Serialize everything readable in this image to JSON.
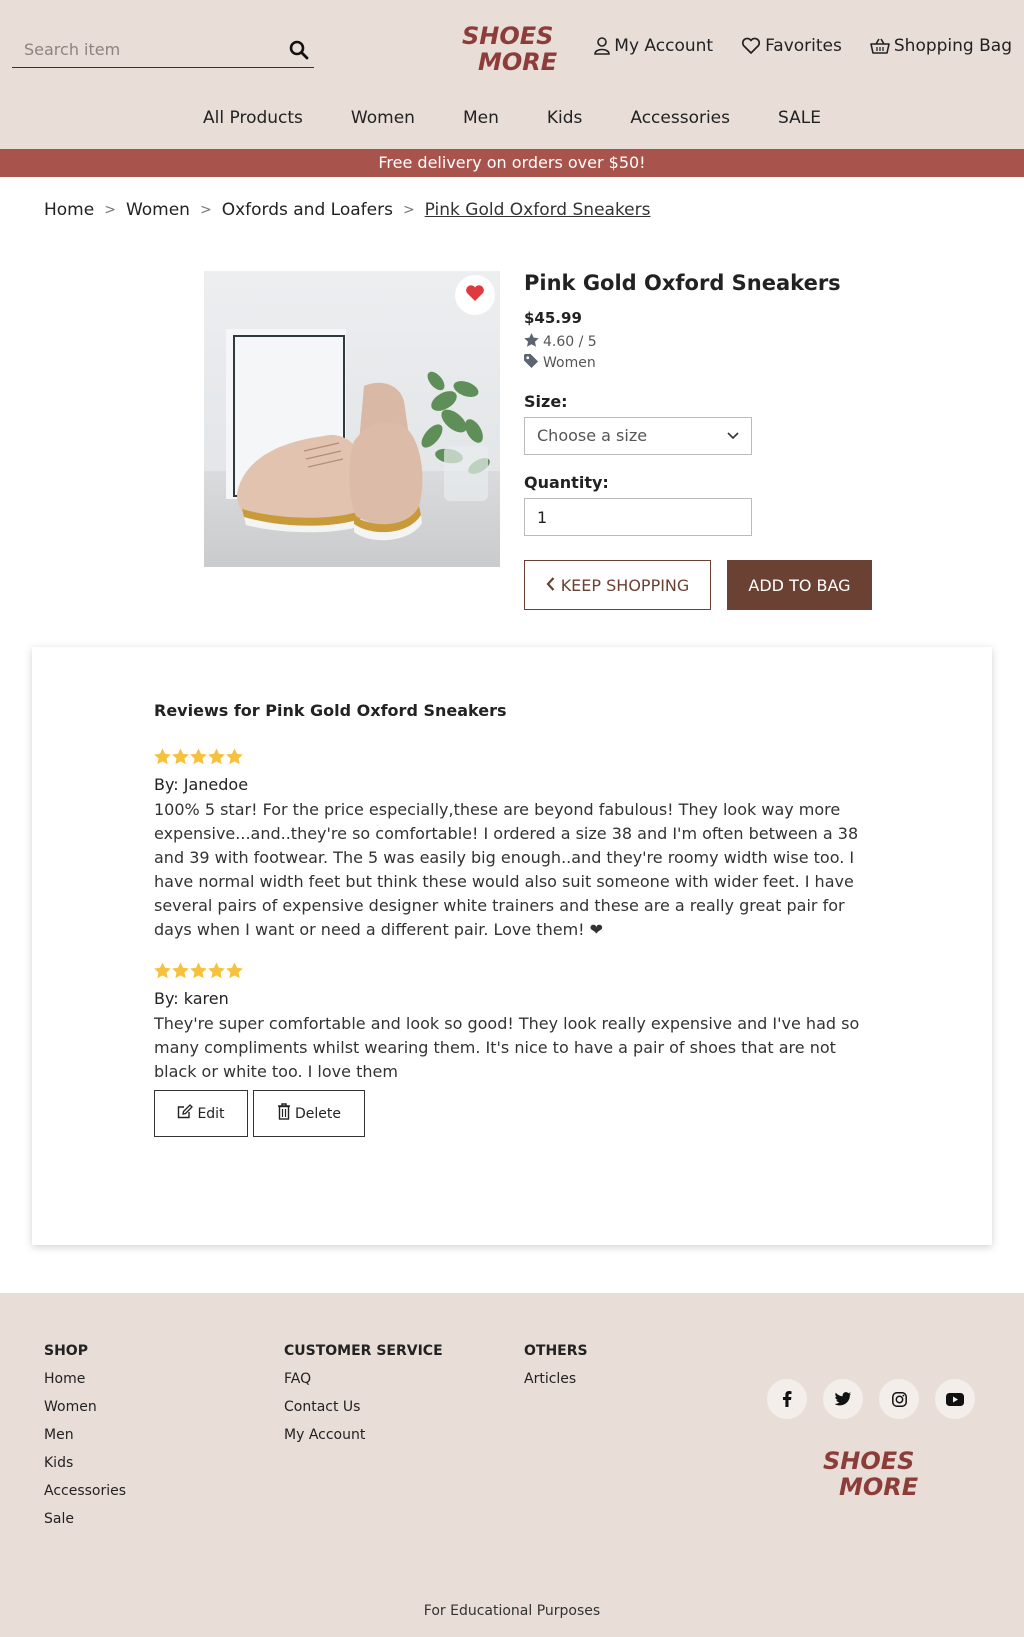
{
  "header": {
    "search_placeholder": "Search item",
    "logo_line1": "SHOES &",
    "logo_line2": "MORE",
    "account_label": "My Account",
    "favorites_label": "Favorites",
    "bag_label": "Shopping Bag"
  },
  "nav": {
    "items": [
      "All Products",
      "Women",
      "Men",
      "Kids",
      "Accessories",
      "SALE"
    ]
  },
  "promo": "Free delivery on orders over $50!",
  "breadcrumb": {
    "home": "Home",
    "sep": ">",
    "category": "Women",
    "subcategory": "Oxfords and Loafers",
    "current": "Pink Gold Oxford Sneakers"
  },
  "product": {
    "title": "Pink Gold Oxford Sneakers",
    "price": "$45.99",
    "rating": "4.60 / 5",
    "category": "Women",
    "size_label": "Size:",
    "size_placeholder": "Choose a size",
    "quantity_label": "Quantity:",
    "quantity_value": "1",
    "keep_shopping_label": "KEEP SHOPPING",
    "add_to_bag_label": "ADD TO BAG",
    "favorited": true
  },
  "reviews": {
    "title": "Reviews for Pink Gold Oxford Sneakers",
    "items": [
      {
        "stars": 5,
        "author": "By: Janedoe",
        "text": "100% 5 star! For the price especially,these are beyond fabulous! They look way more expensive...and..they're so comfortable! I ordered a size 38 and I'm often between a 38 and 39 with footwear. The 5 was easily big enough..and they're roomy width wise too. I have normal width feet but think these would also suit someone with wider feet. I have several pairs of expensive designer white trainers and these are a really great pair for days when I want or need a different pair. Love them! ❤"
      },
      {
        "stars": 5,
        "author": "By: karen",
        "text": "They're super comfortable and look so good! They look really expensive and I've had so many compliments whilst wearing them. It's nice to have a pair of shoes that are not black or white too. I love them",
        "edit_label": "Edit",
        "delete_label": "Delete"
      }
    ]
  },
  "footer": {
    "shop": {
      "heading": "SHOP",
      "links": [
        "Home",
        "Women",
        "Men",
        "Kids",
        "Accessories",
        "Sale"
      ]
    },
    "customer_service": {
      "heading": "CUSTOMER SERVICE",
      "links": [
        "FAQ",
        "Contact Us",
        "My Account"
      ]
    },
    "others": {
      "heading": "OTHERS",
      "links": [
        "Articles"
      ]
    },
    "social_icons": [
      "facebook-icon",
      "twitter-icon",
      "instagram-icon",
      "youtube-icon"
    ],
    "note": "For Educational Purposes"
  },
  "colors": {
    "header_bg": "#e9ddd7",
    "promo_bg": "#a8544d",
    "brand_brown": "#6b4133",
    "star_gold": "#f6c23e",
    "heart_red": "#e03a3e",
    "logo_red": "#8c3d3a",
    "logo_dark": "#3b4a55"
  }
}
